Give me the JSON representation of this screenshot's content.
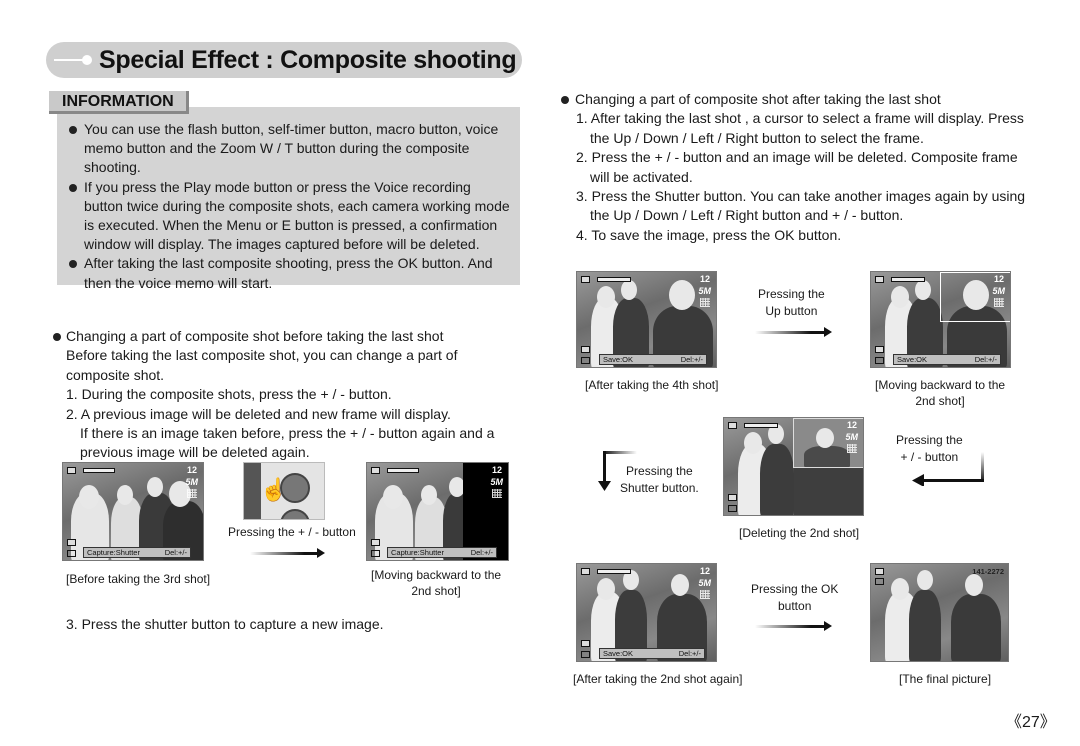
{
  "header": {
    "title": "Special Effect : Composite shooting"
  },
  "information": {
    "tab_label": "INFORMATION",
    "bullets": [
      "You can use the flash button, self-timer button, macro button, voice memo button and the Zoom W / T button during the composite shooting.",
      "If you press the Play mode button or press the Voice recording button twice during the composite shots, each camera working mode is executed. When the Menu or  E button is pressed, a confirmation window will display. The images captured before will be deleted.",
      "After taking the last composite shooting, press the OK button. And then the voice memo will start."
    ]
  },
  "before_last": {
    "heading": "Changing a part of composite shot before taking the last shot",
    "intro": "Before taking the last composite shot, you can change a part of composite shot.",
    "step1": "1. During the composite shots, press the + / - button.",
    "step2": "2. A previous image will be deleted and new frame will display.",
    "step2_cont": "If there is an image taken before, press the + / - button again and a previous image will be deleted again.",
    "step3": "3. Press the shutter button to capture a new image.",
    "screen_left": {
      "count": "12",
      "size": "5M",
      "label_left": "Capture:Shutter",
      "label_right": "Del:+/-",
      "caption": "[Before taking the 3rd shot]"
    },
    "button_caption": "Pressing the + / - button",
    "screen_right": {
      "count": "12",
      "size": "5M",
      "label_left": "Capture:Shutter",
      "label_right": "Del:+/-",
      "caption_line1": "[Moving backward to the",
      "caption_line2": "2nd shot]"
    }
  },
  "after_last": {
    "heading": "Changing a part of composite shot after taking the last shot",
    "steps": [
      "1. After taking the last shot , a cursor to select a frame will display. Press the Up / Down / Left / Right button to select the frame.",
      "2. Press the + / - button and an image will be deleted. Composite frame will be activated.",
      "3. Press the Shutter button. You can take another images again by using the Up / Down / Left / Right button and + / - button.",
      "4. To save the image, press the OK button."
    ],
    "screen_4th": {
      "count": "12",
      "size": "5M",
      "label_left": "Save:OK",
      "label_right": "Del:+/-",
      "caption": "[After taking the 4th shot]"
    },
    "arrow_up_line1": "Pressing the",
    "arrow_up_line2": "Up button",
    "screen_back": {
      "count": "12",
      "size": "5M",
      "label_left": "Save:OK",
      "label_right": "Del:+/-",
      "caption_line1": "[Moving backward to the",
      "caption_line2": "2nd shot]"
    },
    "arrow_pm_line1": "Pressing the",
    "arrow_pm_line2": "+ / - button",
    "screen_delete": {
      "count": "12",
      "size": "5M",
      "caption": "[Deleting the 2nd shot]"
    },
    "arrow_shutter_line1": "Pressing the",
    "arrow_shutter_line2": "Shutter button.",
    "screen_again": {
      "count": "12",
      "size": "5M",
      "label_left": "Save:OK",
      "label_right": "Del:+/-",
      "caption": "[After taking the 2nd shot again]"
    },
    "arrow_ok_line1": "Pressing the OK",
    "arrow_ok_line2": "button",
    "screen_final": {
      "file_no": "141-2272",
      "caption": "[The final picture]"
    }
  },
  "page_number": "《27》"
}
